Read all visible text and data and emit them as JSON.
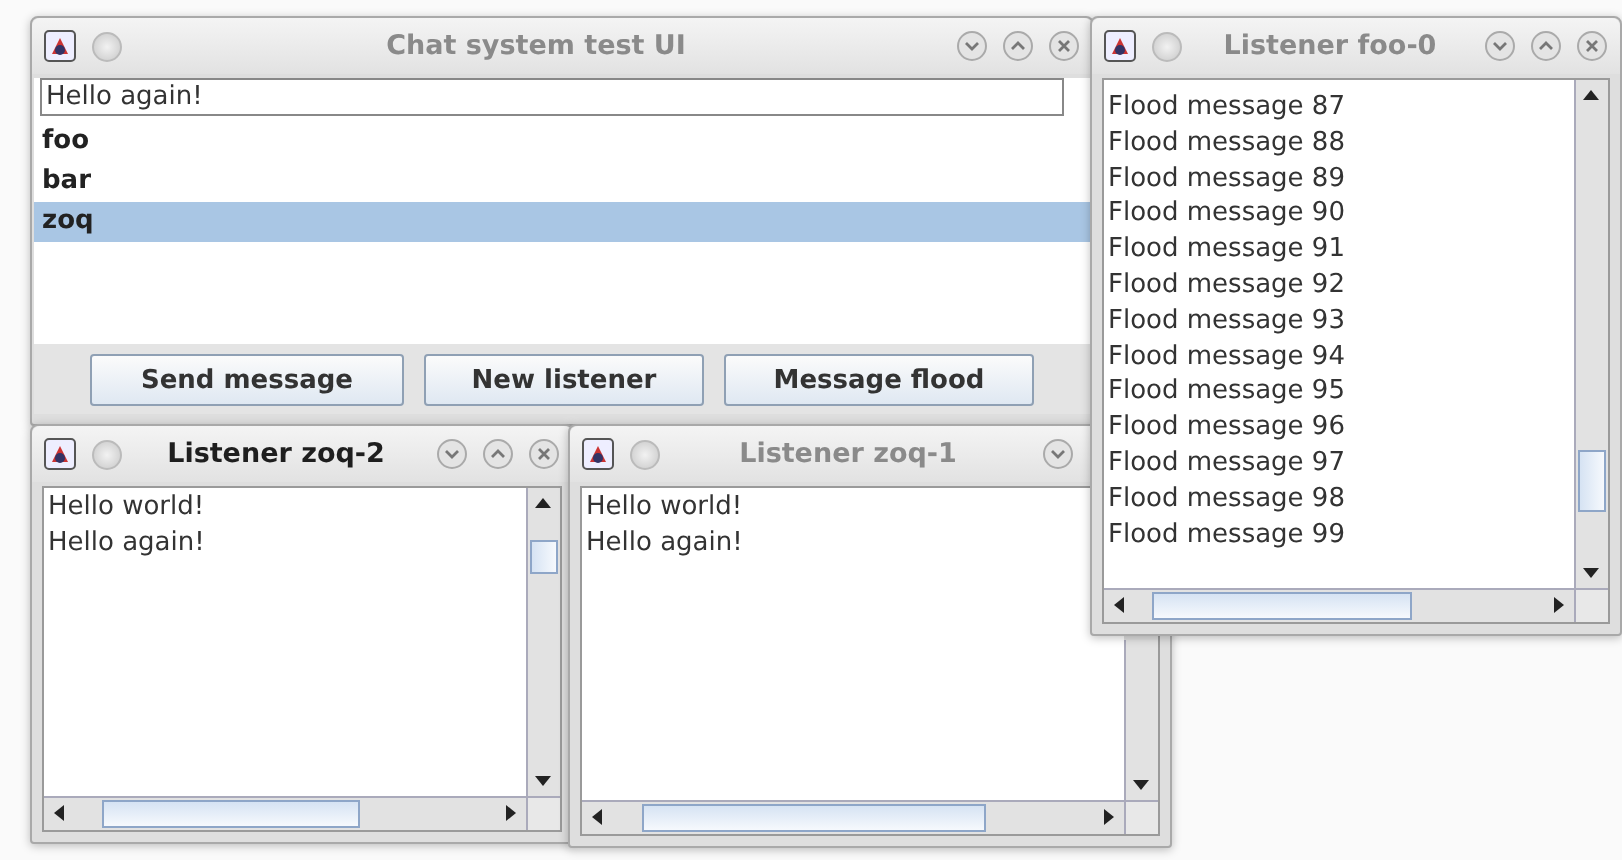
{
  "windows": [
    {
      "kind": "main",
      "title": "Chat system test UI",
      "active": false,
      "message_field": {
        "value": "Hello again!"
      },
      "listeners": [
        {
          "name": "foo",
          "selected": false
        },
        {
          "name": "bar",
          "selected": false
        },
        {
          "name": "zoq",
          "selected": true
        }
      ],
      "buttons": [
        "Send message",
        "New listener",
        "Message flood"
      ]
    },
    {
      "kind": "listener",
      "title": "Listener zoq-2",
      "active": true,
      "lines": [
        "Hello world!",
        "Hello again!"
      ]
    },
    {
      "kind": "listener",
      "title": "Listener zoq-1",
      "active": false,
      "lines": [
        "Hello world!",
        "Hello again!"
      ]
    },
    {
      "kind": "listener",
      "title": "Listener foo-0",
      "active": false,
      "lines": [
        "Flood message 87",
        "Flood message 88",
        "Flood message 89",
        "Flood message 90",
        "Flood message 91",
        "Flood message 92",
        "Flood message 93",
        "Flood message 94",
        "Flood message 95",
        "Flood message 96",
        "Flood message 97",
        "Flood message 98",
        "Flood message 99"
      ]
    }
  ]
}
